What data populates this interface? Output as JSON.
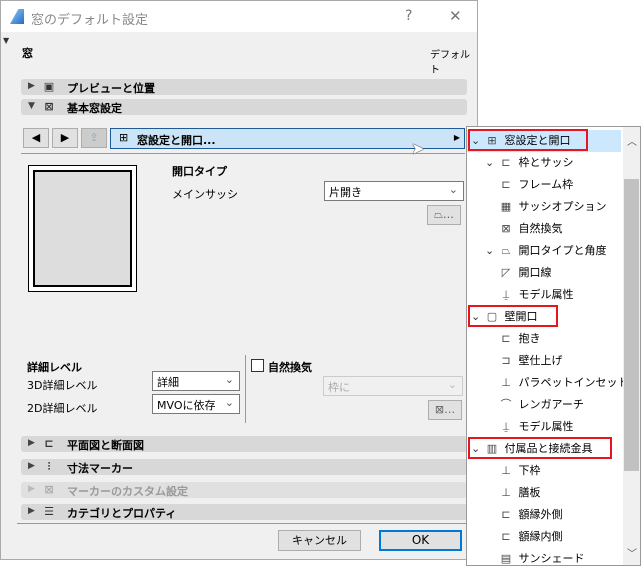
{
  "window": {
    "title": "窓のデフォルト設定",
    "help": "?",
    "close": "✕"
  },
  "header": {
    "left": "窓",
    "right": "デフォルト"
  },
  "sections": {
    "preview": "プレビューと位置",
    "basic": "基本窓設定",
    "plan": "平面図と断面図",
    "dimension": "寸法マーカー",
    "marker_custom": "マーカーのカスタム設定",
    "category": "カテゴリとプロパティ"
  },
  "nav": {
    "prev": "◀",
    "next": "▶",
    "current": "窓設定と開口..."
  },
  "opening": {
    "heading": "開口タイプ",
    "sash_label": "メインサッシ",
    "sash_value": "片開き"
  },
  "detail": {
    "heading": "詳細レベル",
    "d3_label": "3D詳細レベル",
    "d3_value": "詳細",
    "d2_label": "2D詳細レベル",
    "d2_value": "MVOに依存"
  },
  "vent": {
    "label": "自然換気",
    "checked": false,
    "select_value": "枠に"
  },
  "footer": {
    "cancel": "キャンセル",
    "ok": "OK"
  },
  "tree": [
    {
      "label": "窓設定と開口",
      "level": 0,
      "expanded": true,
      "icon": "window-grid-icon"
    },
    {
      "label": "枠とサッシ",
      "level": 1,
      "expanded": true,
      "icon": "frame-icon"
    },
    {
      "label": "フレーム枠",
      "level": 2,
      "icon": "frame-icon"
    },
    {
      "label": "サッシオプション",
      "level": 2,
      "icon": "sash-grid-icon"
    },
    {
      "label": "自然換気",
      "level": 2,
      "icon": "ventilation-icon"
    },
    {
      "label": "開口タイプと角度",
      "level": 1,
      "expanded": true,
      "icon": "opening-angle-icon"
    },
    {
      "label": "開口線",
      "level": 2,
      "icon": "opening-line-icon"
    },
    {
      "label": "モデル属性",
      "level": 1,
      "icon": "brush-icon"
    },
    {
      "label": "壁開口",
      "level": 0,
      "expanded": true,
      "icon": "wall-opening-icon"
    },
    {
      "label": "抱き",
      "level": 1,
      "icon": "reveal-icon"
    },
    {
      "label": "壁仕上げ",
      "level": 1,
      "icon": "wall-finish-icon"
    },
    {
      "label": "パラペットインセット",
      "level": 1,
      "icon": "parapet-icon"
    },
    {
      "label": "レンガアーチ",
      "level": 1,
      "icon": "arch-icon"
    },
    {
      "label": "モデル属性",
      "level": 1,
      "icon": "brush-icon"
    },
    {
      "label": "付属品と接続金具",
      "level": 0,
      "expanded": true,
      "icon": "accessory-icon"
    },
    {
      "label": "下枠",
      "level": 1,
      "icon": "sill-icon"
    },
    {
      "label": "膳板",
      "level": 1,
      "icon": "board-icon"
    },
    {
      "label": "額縁外側",
      "level": 1,
      "icon": "casing-out-icon"
    },
    {
      "label": "額縁内側",
      "level": 1,
      "icon": "casing-in-icon"
    },
    {
      "label": "サンシェード",
      "level": 1,
      "icon": "sunshade-icon"
    }
  ]
}
